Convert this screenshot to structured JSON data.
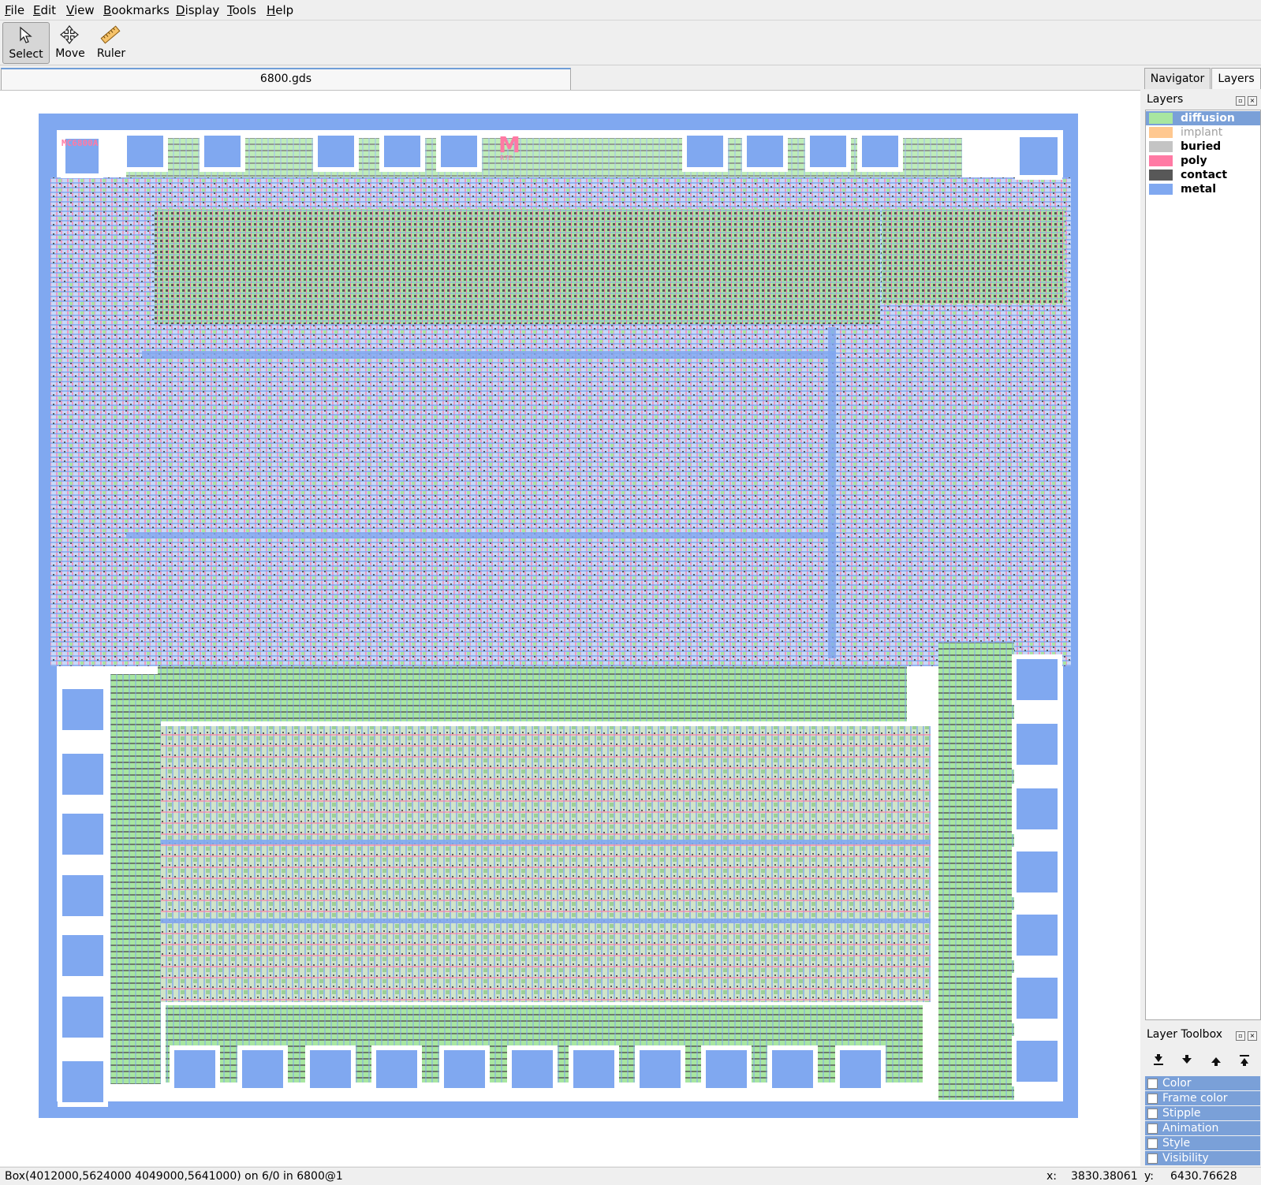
{
  "menu": [
    {
      "mnemonic": "F",
      "rest": "ile"
    },
    {
      "mnemonic": "E",
      "rest": "dit"
    },
    {
      "mnemonic": "V",
      "rest": "iew"
    },
    {
      "mnemonic": "B",
      "rest": "ookmarks"
    },
    {
      "mnemonic": "D",
      "rest": "isplay"
    },
    {
      "mnemonic": "T",
      "rest": "ools"
    },
    {
      "mnemonic": "H",
      "rest": "elp"
    }
  ],
  "toolbar": {
    "select_label": "Select",
    "move_label": "Move",
    "ruler_label": "Ruler",
    "active_tool": "select"
  },
  "document": {
    "tab_title": "6800.gds",
    "logo_left": "MC6800A",
    "logo_center": "M",
    "logo_year": "R7E"
  },
  "sidebar": {
    "tabs": [
      "Navigator",
      "Layers"
    ],
    "selected_tab": "Layers",
    "layers_title": "Layers",
    "layers": [
      {
        "name": "diffusion",
        "color": "#a8e6a0",
        "selected": true,
        "dim": false
      },
      {
        "name": "implant",
        "color": "#ffc890",
        "selected": false,
        "dim": true
      },
      {
        "name": "buried",
        "color": "#c4c4c4",
        "selected": false,
        "dim": false
      },
      {
        "name": "poly",
        "color": "#ff7aa4",
        "selected": false,
        "dim": false
      },
      {
        "name": "contact",
        "color": "#585858",
        "selected": false,
        "dim": false
      },
      {
        "name": "metal",
        "color": "#80a8f0",
        "selected": false,
        "dim": false
      }
    ],
    "toolbox_title": "Layer Toolbox",
    "toolbox_buttons": [
      "move-to-bottom-icon",
      "move-down-icon",
      "move-up-icon",
      "move-to-top-icon"
    ],
    "properties": [
      "Color",
      "Frame color",
      "Stipple",
      "Animation",
      "Style",
      "Visibility"
    ]
  },
  "status": {
    "message": "Box(4012000,5624000 4049000,5641000) on 6/0 in 6800@1",
    "x_label": "x:",
    "x_value": "3830.38061",
    "y_label": "y:",
    "y_value": "6430.76628"
  },
  "colors": {
    "metal": "#80a8f0",
    "diffusion": "#a8e6a0",
    "poly": "#ff7aa4",
    "contact": "#585858",
    "selection": "#7aa0d8"
  }
}
